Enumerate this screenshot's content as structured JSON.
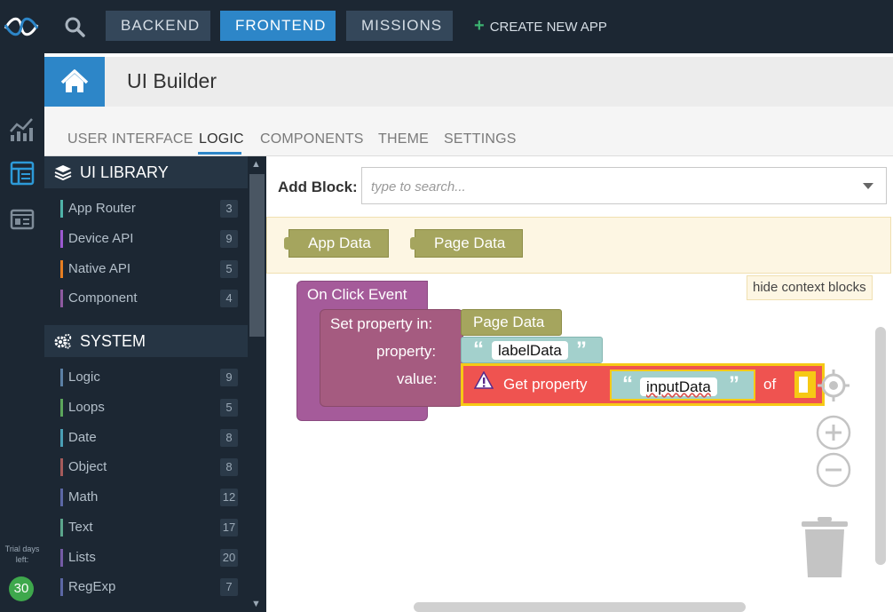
{
  "topbar": {
    "nav": [
      "BACKEND",
      "FRONTEND",
      "MISSIONS"
    ],
    "active_nav": "FRONTEND",
    "create_app": "CREATE NEW APP",
    "icons": {
      "logo": "wave-logo-icon",
      "search": "search-icon"
    }
  },
  "rail": {
    "icons": [
      "analytics-icon",
      "ui-builder-icon",
      "dashboard-icon"
    ],
    "trial_label": "Trial days left:",
    "trial_days": "30"
  },
  "header": {
    "title": "UI Builder",
    "home_icon": "home-icon"
  },
  "tabs": [
    "USER INTERFACE",
    "LOGIC",
    "COMPONENTS",
    "THEME",
    "SETTINGS"
  ],
  "active_tab": "LOGIC",
  "library": {
    "sections": [
      {
        "title": "UI LIBRARY",
        "icon": "layers-icon",
        "items": [
          {
            "label": "App Router",
            "count": "3",
            "color": "#4fb3a9"
          },
          {
            "label": "Device API",
            "count": "9",
            "color": "#9b59d0"
          },
          {
            "label": "Native API",
            "count": "5",
            "color": "#e67e22"
          },
          {
            "label": "Component",
            "count": "4",
            "color": "#8e5aa0"
          }
        ]
      },
      {
        "title": "SYSTEM",
        "icon": "gears-icon",
        "items": [
          {
            "label": "Logic",
            "count": "9",
            "color": "#5b80a5"
          },
          {
            "label": "Loops",
            "count": "5",
            "color": "#5ba55b"
          },
          {
            "label": "Date",
            "count": "8",
            "color": "#4a9fb5"
          },
          {
            "label": "Object",
            "count": "8",
            "color": "#a55b5b"
          },
          {
            "label": "Math",
            "count": "12",
            "color": "#5b67a5"
          },
          {
            "label": "Text",
            "count": "17",
            "color": "#5ba58c"
          },
          {
            "label": "Lists",
            "count": "20",
            "color": "#745ba5"
          },
          {
            "label": "RegExp",
            "count": "7",
            "color": "#5b67a5"
          }
        ]
      }
    ]
  },
  "workspace": {
    "add_block_label": "Add Block:",
    "search_placeholder": "type to search...",
    "context_blocks": [
      "App Data",
      "Page Data"
    ],
    "hide_context": "hide context blocks",
    "blocks": {
      "event": "On Click Event",
      "set_property": "Set property in:",
      "property_label": "property:",
      "value_label": "value:",
      "target": "Page Data",
      "property_value": "labelData",
      "get_property": "Get property",
      "get_property_value": "inputData",
      "of_label": "of",
      "open_quote": "“",
      "close_quote": "”"
    },
    "controls": [
      "recenter-icon",
      "zoom-in-icon",
      "zoom-out-icon",
      "trash-icon"
    ]
  }
}
